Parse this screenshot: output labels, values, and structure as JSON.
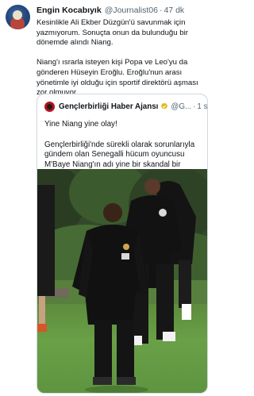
{
  "tweet": {
    "author_name": "Engin Kocabıyık",
    "author_handle": "@Journalist06",
    "separator": "·",
    "time": "47 dk",
    "paragraph1": "Kesinlikle Ali Ekber Düzgün'ü savunmak için yazmıyorum. Sonuçta onun da bulunduğu bir dönemde alındı Niang.",
    "paragraph2": "Niang'ı ısrarla isteyen kişi Popa ve Leo'yu da gönderen Hüseyin Eroğlu. Eroğlu'nun arası yönetimle iyi olduğu için sportif direktörü aşması zor olmuyor.",
    "emojis": "👇👇👇"
  },
  "quote": {
    "name": "Gençlerbirliği Haber Ajansı",
    "handle": "@G...",
    "separator": "·",
    "time": "1 sa",
    "line1": "Yine Niang yine olay!",
    "paragraph2": "Gençlerbirliği'nde sürekli olarak sorunlarıyla gündem olan Senegalli hücum oyuncusu M'Baye Niang'ın adı yine bir skandal bir olayın ...",
    "photo_alt": "Football players training on a grass pitch"
  },
  "icons": {
    "author_avatar": "author-avatar",
    "quote_avatar": "club-logo",
    "verified": "verified-badge-icon"
  },
  "colors": {
    "text": "#0f1419",
    "secondary": "#536471",
    "border": "#cfd9de",
    "verified_gold": "#e2b719"
  }
}
